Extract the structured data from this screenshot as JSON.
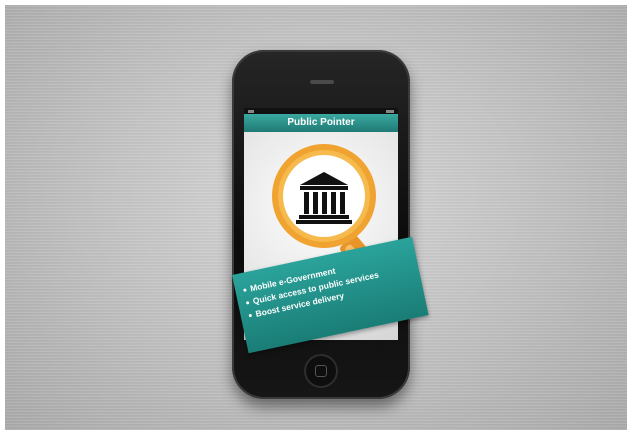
{
  "app": {
    "title": "Public Pointer"
  },
  "features": [
    "Mobile e-Government",
    "Quick access to public services",
    "Boost service delivery"
  ],
  "icons": {
    "magnifier": "magnifying-glass-icon",
    "building": "government-building-icon"
  },
  "colors": {
    "accent_teal": "#1f8a83",
    "magnifier_orange": "#f0a330",
    "phone_body": "#111111",
    "background_metal": "#c4c4c4"
  }
}
